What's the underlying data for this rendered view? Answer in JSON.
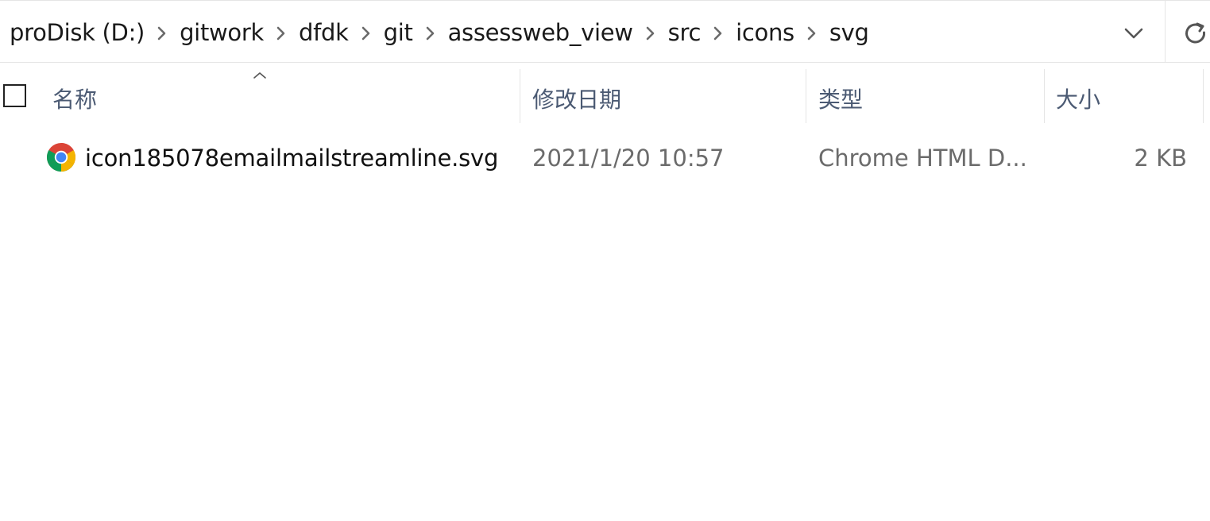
{
  "address": {
    "crumbs": [
      "proDisk (D:)",
      "gitwork",
      "dfdk",
      "git",
      "assessweb_view",
      "src",
      "icons",
      "svg"
    ],
    "separator_icon": "chevron-right-icon",
    "dropdown_icon": "chevron-down-icon",
    "refresh_icon": "refresh-icon"
  },
  "columns": {
    "name": "名称",
    "modified": "修改日期",
    "type": "类型",
    "size": "大小",
    "sort_indicator": "sort-ascending-icon"
  },
  "files": [
    {
      "icon": "chrome-icon",
      "name": "icon185078emailmailstreamline.svg",
      "modified": "2021/1/20 10:57",
      "type": "Chrome HTML D...",
      "size": "2 KB"
    }
  ],
  "colors": {
    "header_text": "#4b5a73",
    "secondary_text": "#6b6b6b",
    "primary_text": "#111111",
    "divider": "#e5e5e5"
  }
}
